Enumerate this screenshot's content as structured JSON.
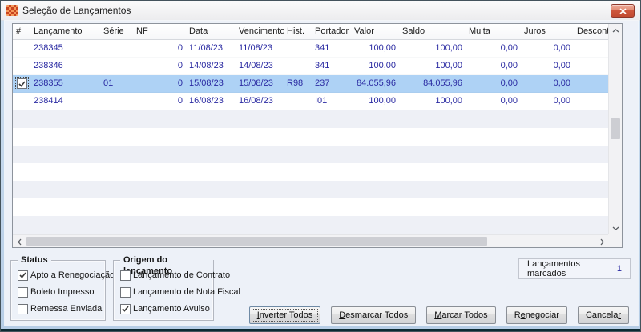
{
  "window": {
    "title": "Seleção de Lançamentos"
  },
  "icons": {
    "app_icon": "orange-mosaic-logo",
    "close_icon": "✕",
    "check_icon": "✓",
    "scroll_up_icon": "chevron-up",
    "scroll_down_icon": "chevron-down",
    "scroll_left_icon": "chevron-left",
    "scroll_right_icon": "chevron-right"
  },
  "colors": {
    "selected_row": "#aed2f5",
    "data_text": "#2a2aa2",
    "close_button": "#c14a30",
    "frame_blue": "#bcd2ea"
  },
  "table": {
    "columns": [
      "#",
      "Lançamento",
      "Série",
      "NF",
      "Data",
      "Vencimento",
      "Hist.",
      "Portador",
      "Valor",
      "Saldo",
      "Multa",
      "Juros",
      "Desconto"
    ],
    "rows": [
      {
        "checked": false,
        "selected": false,
        "lancamento": "238345",
        "serie": "",
        "nf": "0",
        "data": "11/08/23",
        "vencimento": "11/08/23",
        "hist": "",
        "portador": "341",
        "valor": "100,00",
        "saldo": "100,00",
        "multa": "0,00",
        "juros": "0,00",
        "desconto": ""
      },
      {
        "checked": false,
        "selected": false,
        "lancamento": "238346",
        "serie": "",
        "nf": "0",
        "data": "14/08/23",
        "vencimento": "14/08/23",
        "hist": "",
        "portador": "341",
        "valor": "100,00",
        "saldo": "100,00",
        "multa": "0,00",
        "juros": "0,00",
        "desconto": ""
      },
      {
        "checked": true,
        "selected": true,
        "lancamento": "238355",
        "serie": "01",
        "nf": "0",
        "data": "15/08/23",
        "vencimento": "15/08/23",
        "hist": "R98",
        "portador": "237",
        "valor": "84.055,96",
        "saldo": "84.055,96",
        "multa": "0,00",
        "juros": "0,00",
        "desconto": ""
      },
      {
        "checked": false,
        "selected": false,
        "lancamento": "238414",
        "serie": "",
        "nf": "0",
        "data": "16/08/23",
        "vencimento": "16/08/23",
        "hist": "",
        "portador": "I01",
        "valor": "100,00",
        "saldo": "100,00",
        "multa": "0,00",
        "juros": "0,00",
        "desconto": ""
      }
    ]
  },
  "groups": {
    "status": {
      "label": "Status",
      "options": [
        {
          "label": "Apto a Renegociação",
          "checked": true
        },
        {
          "label": "Boleto Impresso",
          "checked": false
        },
        {
          "label": "Remessa Enviada",
          "checked": false
        }
      ]
    },
    "origem": {
      "label": "Origem do lançamento",
      "options": [
        {
          "label": "Lançamento de Contrato",
          "checked": false
        },
        {
          "label": "Lançamento de Nota Fiscal",
          "checked": false
        },
        {
          "label": "Lançamento Avulso",
          "checked": true
        }
      ]
    }
  },
  "summary": {
    "label": "Lançamentos marcados",
    "value": "1"
  },
  "buttons": {
    "inverter": {
      "pre": "",
      "key": "I",
      "post": "nverter Todos"
    },
    "desmarcar": {
      "pre": "",
      "key": "D",
      "post": "esmarcar Todos"
    },
    "marcar": {
      "pre": "",
      "key": "M",
      "post": "arcar Todos"
    },
    "renegociar": {
      "pre": "R",
      "key": "e",
      "post": "negociar"
    },
    "cancelar": {
      "pre": "Cancela",
      "key": "r",
      "post": ""
    }
  }
}
